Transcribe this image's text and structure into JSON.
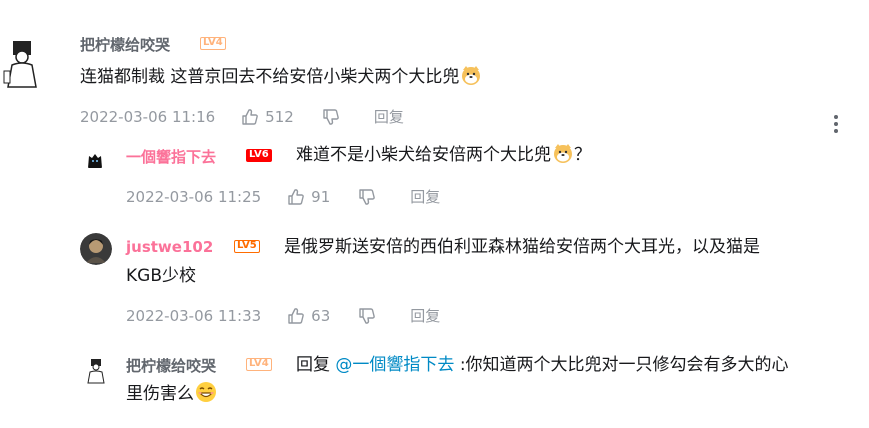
{
  "main_comment": {
    "username": "把柠檬给咬哭",
    "level": "LV4",
    "content": "连猫都制裁  这普京回去不给安倍小柴犬两个大比兜",
    "emoji": "doge-emoji",
    "time": "2022-03-06 11:16",
    "likes": "512",
    "reply_label": "回复"
  },
  "replies": [
    {
      "username": "一個響指下去",
      "level": "LV6",
      "content": "难道不是小柴犬给安倍两个大比兜",
      "content_suffix": "？",
      "emoji": "doge-emoji",
      "time": "2022-03-06 11:25",
      "likes": "91",
      "reply_label": "回复"
    },
    {
      "username": "justwe102",
      "level": "LV5",
      "content_line1": "是俄罗斯送安倍的西伯利亚森林猫给安倍两个大耳光，以及猫是",
      "content_line2": "KGB少校",
      "time": "2022-03-06 11:33",
      "likes": "63",
      "reply_label": "回复"
    },
    {
      "username": "把柠檬给咬哭",
      "level": "LV4",
      "reply_prefix": "回复",
      "mention": "@一個響指下去",
      "content_line1": ":你知道两个大比兜对一只修勾会有多大的心",
      "content_line2": "里伤害么",
      "emoji": "smile-emoji"
    }
  ],
  "colors": {
    "pink_username": "#fb7299",
    "mention": "#008ac5",
    "meta_gray": "#9499a0"
  }
}
